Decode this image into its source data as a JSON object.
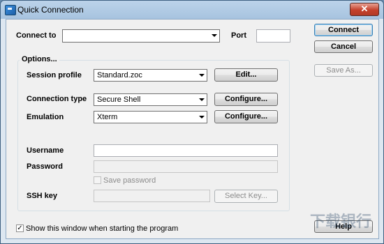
{
  "window": {
    "title": "Quick Connection",
    "close_glyph": "✕"
  },
  "connect_to": {
    "label": "Connect to",
    "value": ""
  },
  "port": {
    "label": "Port",
    "value": ""
  },
  "buttons": {
    "connect": "Connect",
    "cancel": "Cancel",
    "save_as": "Save As...",
    "help": "Help"
  },
  "options": {
    "title": "Options...",
    "session_profile": {
      "label": "Session profile",
      "value": "Standard.zoc",
      "button": "Edit..."
    },
    "connection_type": {
      "label": "Connection type",
      "value": "Secure Shell",
      "button": "Configure..."
    },
    "emulation": {
      "label": "Emulation",
      "value": "Xterm",
      "button": "Configure..."
    },
    "username": {
      "label": "Username",
      "value": ""
    },
    "password": {
      "label": "Password",
      "value": ""
    },
    "save_password": {
      "label": "Save password",
      "checked": false
    },
    "ssh_key": {
      "label": "SSH key",
      "value": "",
      "button": "Select Key..."
    }
  },
  "show_window": {
    "label": "Show this window when starting the program",
    "checked": true,
    "check_glyph": "✓"
  },
  "watermark": "下载银行"
}
